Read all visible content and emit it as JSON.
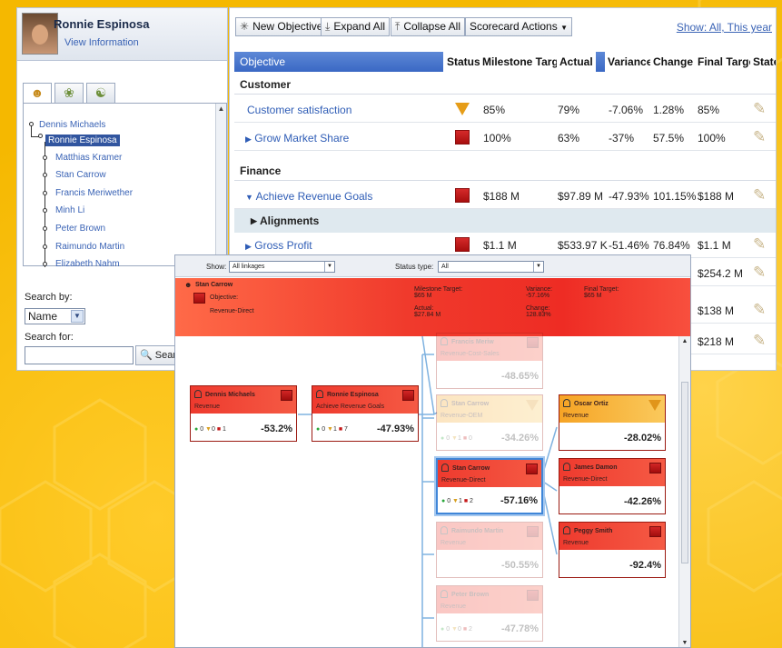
{
  "profile": {
    "name": "Ronnie Espinosa",
    "link": "View Information"
  },
  "tree": {
    "nodes": [
      "Dennis Michaels",
      "Ronnie Espinosa",
      "Matthias Kramer",
      "Stan Carrow",
      "Francis Meriwether",
      "Minh Li",
      "Peter Brown",
      "Raimundo Martin",
      "Elizabeth Nahm"
    ]
  },
  "search": {
    "by_label": "Search by:",
    "by_value": "Name",
    "for_label": "Search for:",
    "for_value": "",
    "button": "Search"
  },
  "toolbar": {
    "new_objective": "New Objective",
    "expand_all": "Expand All",
    "collapse_all": "Collapse All",
    "actions": "Scorecard Actions",
    "show_link": "Show: All, This year"
  },
  "columns": {
    "objective": "Objective",
    "status": "Status",
    "milestone": "Milestone Target",
    "actual": "Actual",
    "variance": "Variance",
    "change": "Change",
    "final": "Final Target",
    "state": "State"
  },
  "sections": {
    "customer": "Customer",
    "finance": "Finance"
  },
  "rows": [
    {
      "name": "Customer satisfaction",
      "status": "warning",
      "milestone": "85%",
      "actual": "79%",
      "variance": "-7.06%",
      "change": "1.28%",
      "final": "85%"
    },
    {
      "name": "Grow Market Share",
      "status": "critical",
      "milestone": "100%",
      "actual": "63%",
      "variance": "-37%",
      "change": "57.5%",
      "final": "100%"
    },
    {
      "name": "Achieve Revenue Goals",
      "status": "critical",
      "milestone": "$188 M",
      "actual": "$97.89 M",
      "variance": "-47.93%",
      "change": "101.15%",
      "final": "$188 M"
    },
    {
      "name": "Gross Profit",
      "status": "critical",
      "milestone": "$1.1 M",
      "actual": "$533.97 K",
      "variance": "-51.46%",
      "change": "76.84%",
      "final": "$1.1 M"
    }
  ],
  "alignments_label": "Alignments",
  "hidden_finals": [
    "$254.2 M",
    "$138 M",
    "$218 M"
  ],
  "overlay": {
    "show_label": "Show:",
    "show_value": "All linkages",
    "status_label": "Status type:",
    "status_value": "All",
    "header": {
      "name": "Stan Carrow",
      "objective_label": "Objective:",
      "objective": "Revenue-Direct",
      "milestone_label": "Milestone Target:",
      "milestone": "$65 M",
      "actual_label": "Actual:",
      "actual": "$27.84 M",
      "variance_label": "Variance:",
      "variance": "-57.16%",
      "change_label": "Change:",
      "change": "128.83%",
      "final_label": "Final Target:",
      "final": "$65 M"
    },
    "cards": {
      "dennis": {
        "name": "Dennis Michaels",
        "obj": "Revenue",
        "g": "0",
        "y": "0",
        "r": "1",
        "pct": "-53.2%"
      },
      "ronnie": {
        "name": "Ronnie Espinosa",
        "obj": "Achieve Revenue Goals",
        "g": "0",
        "y": "1",
        "r": "7",
        "pct": "-47.93%"
      },
      "francis": {
        "name": "Francis Meriw",
        "obj": "Revenue-Cost-Sales",
        "pct": "-48.65%"
      },
      "stanA": {
        "name": "Stan Carrow",
        "obj": "Revenue-OEM",
        "g": "0",
        "y": "1",
        "r": "0",
        "pct": "-34.26%"
      },
      "stanB": {
        "name": "Stan Carrow",
        "obj": "Revenue-Direct",
        "g": "0",
        "y": "1",
        "r": "2",
        "pct": "-57.16%"
      },
      "raimundo": {
        "name": "Raimundo Martin",
        "obj": "Revenue",
        "pct": "-50.55%"
      },
      "peter": {
        "name": "Peter Brown",
        "obj": "Revenue",
        "g": "0",
        "y": "0",
        "r": "2",
        "pct": "-47.78%"
      },
      "oscar": {
        "name": "Oscar Ortiz",
        "obj": "Revenue",
        "pct": "-28.02%"
      },
      "james": {
        "name": "James Damon",
        "obj": "Revenue-Direct",
        "pct": "-42.26%"
      },
      "peggy": {
        "name": "Peggy Smith",
        "obj": "Revenue",
        "pct": "-92.4%"
      }
    }
  }
}
